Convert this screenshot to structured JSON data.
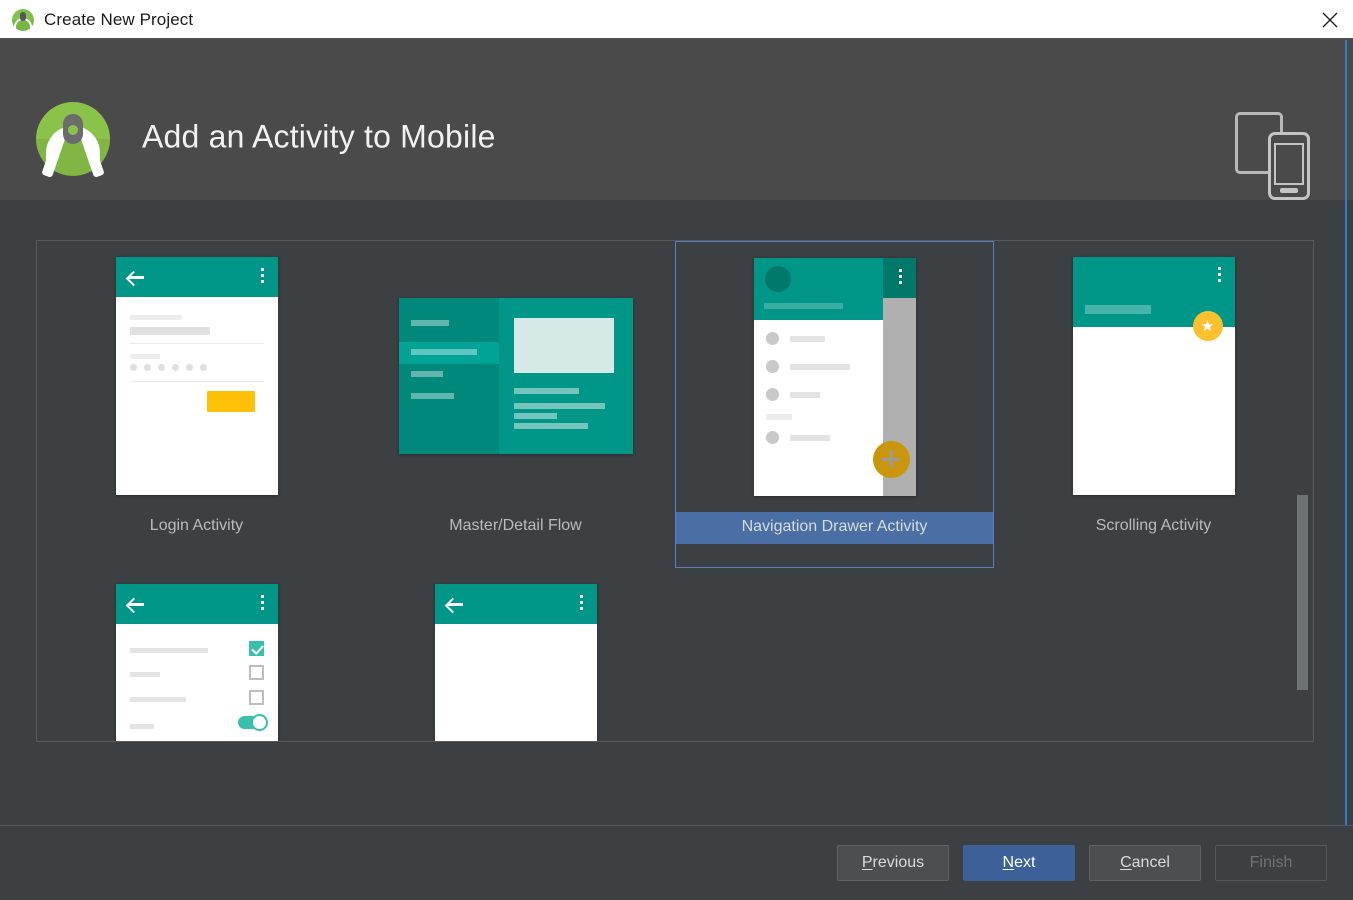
{
  "titlebar": {
    "title": "Create New Project",
    "app_icon": "android-studio-icon",
    "close_icon": "close-icon"
  },
  "header": {
    "logo_icon": "android-studio-logo",
    "title": "Add an Activity to Mobile",
    "device_icon": "tablet-and-phone-icon"
  },
  "templates": [
    {
      "label": "Login Activity",
      "thumb": "login-activity-thumbnail",
      "selected": false
    },
    {
      "label": "Master/Detail Flow",
      "thumb": "master-detail-flow-thumbnail",
      "selected": false
    },
    {
      "label": "Navigation Drawer Activity",
      "thumb": "navigation-drawer-activity-thumbnail",
      "selected": true
    },
    {
      "label": "Scrolling Activity",
      "thumb": "scrolling-activity-thumbnail",
      "selected": false
    },
    {
      "label": "",
      "thumb": "settings-activity-thumbnail",
      "selected": false
    },
    {
      "label": "",
      "thumb": "tabbed-activity-thumbnail",
      "selected": false
    }
  ],
  "scrollbar": {
    "name": "template-list-scrollbar"
  },
  "footer": {
    "previous": {
      "label": "Previous",
      "mnemonic": "P",
      "state": "enabled"
    },
    "next": {
      "label": "Next",
      "mnemonic": "N",
      "state": "default"
    },
    "cancel": {
      "label": "Cancel",
      "mnemonic": "C",
      "state": "enabled"
    },
    "finish": {
      "label": "Finish",
      "mnemonic": "",
      "state": "disabled"
    }
  },
  "colors": {
    "header_band": "#4a4a4a",
    "dialog_background": "#3c4043",
    "selection_blue": "#4a6fa5",
    "selection_border": "#5a7fc0",
    "primary_button": "#3c6098",
    "material_teal": "#009688",
    "material_amber": "#ffc107"
  }
}
